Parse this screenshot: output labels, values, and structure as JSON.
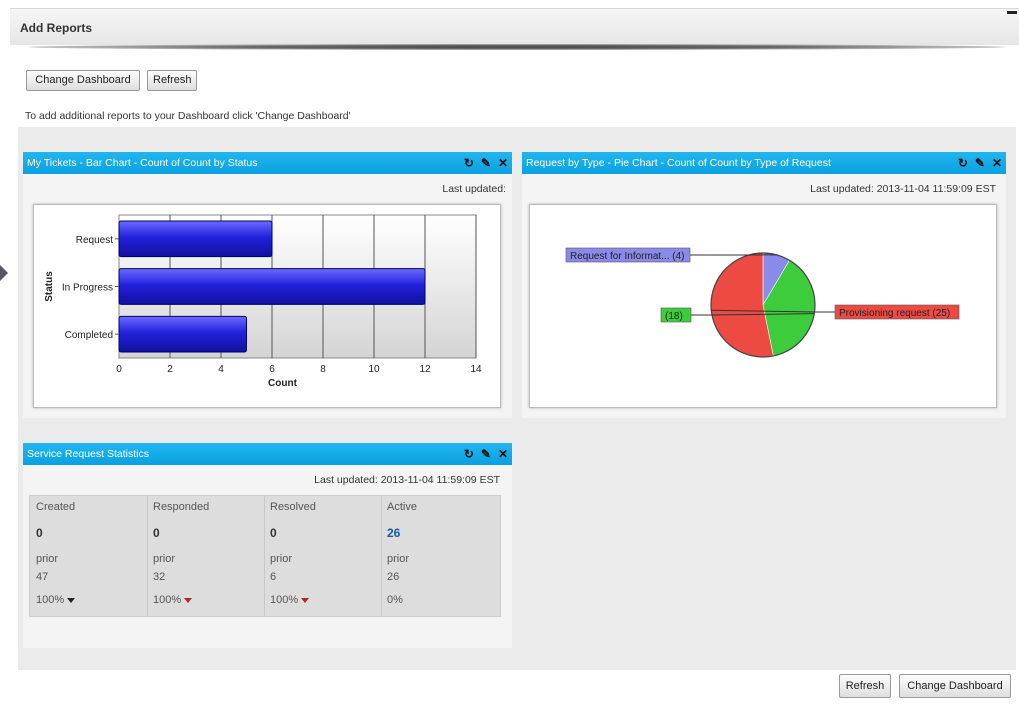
{
  "header": {
    "title": "Add Reports"
  },
  "toolbar": {
    "change_dashboard": "Change Dashboard",
    "refresh": "Refresh"
  },
  "hint": "To add additional reports to your Dashboard click 'Change Dashboard'",
  "panel_bar": {
    "title": "My Tickets - Bar Chart - Count of Count by Status",
    "last_updated": "Last updated:"
  },
  "panel_pie": {
    "title": "Request by Type - Pie Chart - Count of Count by Type of Request",
    "last_updated": "Last updated:  2013-11-04 11:59:09 EST"
  },
  "panel_stats": {
    "title": "Service Request Statistics",
    "last_updated": "Last updated:  2013-11-04 11:59:09 EST",
    "columns": [
      {
        "label": "Created",
        "value": "0",
        "prior_label": "prior",
        "prior": "47",
        "pct": "100%",
        "arrow": "dark"
      },
      {
        "label": "Responded",
        "value": "0",
        "prior_label": "prior",
        "prior": "32",
        "pct": "100%",
        "arrow": "red"
      },
      {
        "label": "Resolved",
        "value": "0",
        "prior_label": "prior",
        "prior": "6",
        "pct": "100%",
        "arrow": "red"
      },
      {
        "label": "Active",
        "value": "26",
        "prior_label": "prior",
        "prior": "26",
        "pct": "0%",
        "arrow": "none"
      }
    ]
  },
  "icons": {
    "refresh": "refresh-icon",
    "edit": "edit-icon",
    "close": "close-icon"
  },
  "footer": {
    "refresh": "Refresh",
    "change_dashboard": "Change Dashboard"
  },
  "chart_data": [
    {
      "type": "bar",
      "orientation": "horizontal",
      "categories": [
        "Request",
        "In Progress",
        "Completed"
      ],
      "values": [
        6,
        12,
        5
      ],
      "xlabel": "Count",
      "ylabel": "Status",
      "xlim": [
        0,
        14
      ],
      "xticks": [
        "0",
        "2",
        "4",
        "6",
        "8",
        "10",
        "12",
        "14"
      ],
      "color": "#2222dd",
      "grid": true
    },
    {
      "type": "pie",
      "slices": [
        {
          "label": "Request for Informat... (4)",
          "value": 4,
          "color": "#8a8ae8"
        },
        {
          "label": "(18)",
          "value": 18,
          "color": "#3ccc3c"
        },
        {
          "label": "Provisioning request (25)",
          "value": 25,
          "color": "#ee4a44"
        }
      ]
    }
  ]
}
